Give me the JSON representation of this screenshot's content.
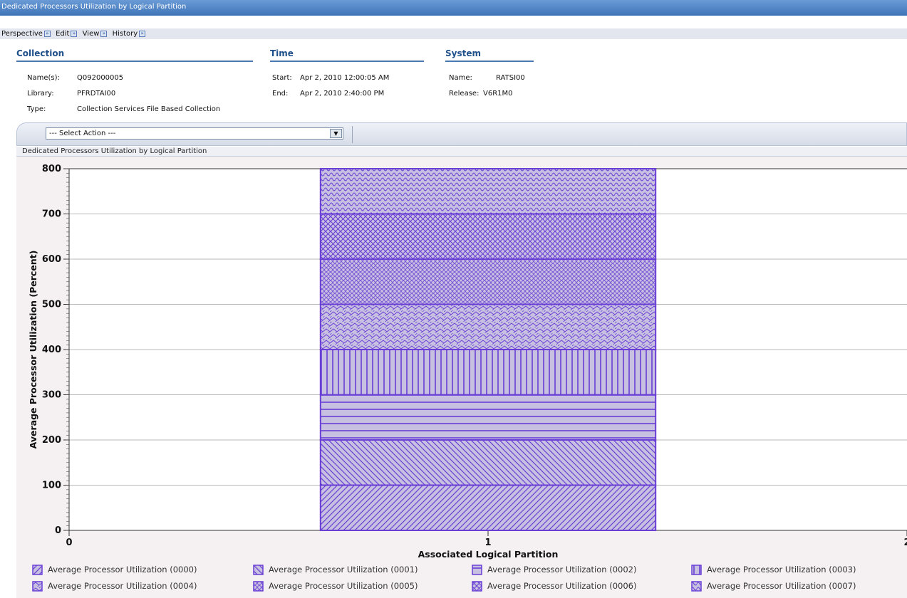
{
  "window": {
    "title": "Dedicated Processors Utilization by Logical Partition"
  },
  "menu": {
    "items": [
      "Perspective",
      "Edit",
      "View",
      "History"
    ]
  },
  "collection": {
    "heading": "Collection",
    "name_label": "Name(s):",
    "name_value": "Q092000005",
    "library_label": "Library:",
    "library_value": "PFRDTAI00",
    "type_label": "Type:",
    "type_value": "Collection Services File Based Collection"
  },
  "time": {
    "heading": "Time",
    "start_label": "Start:",
    "start_value": "Apr 2, 2010 12:00:05 AM",
    "end_label": "End:",
    "end_value": "Apr 2, 2010 2:40:00 PM"
  },
  "system": {
    "heading": "System",
    "name_label": "Name:",
    "name_value": "RATSI00",
    "release_label": "Release:",
    "release_value": "V6R1M0"
  },
  "action": {
    "selected": "--- Select Action ---"
  },
  "chart_panel": {
    "title": "Dedicated Processors Utilization by Logical Partition"
  },
  "colors": {
    "pattern_stroke": "#6a3fd6",
    "fill": "#c7c0e0",
    "accent": "#20508a"
  },
  "chart_data": {
    "type": "bar",
    "stacked": true,
    "xlabel": "Associated Logical Partition",
    "ylabel": "Average Processor Utilization (Percent)",
    "categories": [
      1
    ],
    "xlim": [
      0,
      2
    ],
    "x_ticks": [
      "0",
      "1",
      "2"
    ],
    "ylim": [
      0,
      800
    ],
    "y_ticks": [
      "0",
      "100",
      "200",
      "300",
      "400",
      "500",
      "600",
      "700",
      "800"
    ],
    "grid": true,
    "legend_position": "bottom",
    "series": [
      {
        "name": "Average Processor Utilization (0000)",
        "values": [
          100
        ],
        "pattern": "diag-forward"
      },
      {
        "name": "Average Processor Utilization (0001)",
        "values": [
          100
        ],
        "pattern": "diag-back"
      },
      {
        "name": "Average Processor Utilization (0002)",
        "values": [
          100
        ],
        "pattern": "horizontal"
      },
      {
        "name": "Average Processor Utilization (0003)",
        "values": [
          100
        ],
        "pattern": "vertical"
      },
      {
        "name": "Average Processor Utilization (0004)",
        "values": [
          100
        ],
        "pattern": "zigzag"
      },
      {
        "name": "Average Processor Utilization (0005)",
        "values": [
          100
        ],
        "pattern": "circles"
      },
      {
        "name": "Average Processor Utilization (0006)",
        "values": [
          100
        ],
        "pattern": "crosshatch"
      },
      {
        "name": "Average Processor Utilization (0007)",
        "values": [
          100
        ],
        "pattern": "waves"
      }
    ]
  }
}
